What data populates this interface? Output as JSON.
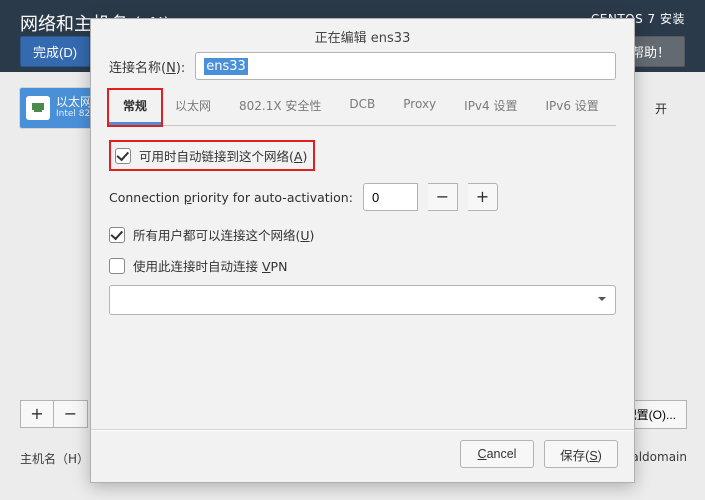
{
  "installer": {
    "page_title": "网络和主机名 (_N)",
    "right_title": "CENTOS 7 安装",
    "done_label": "完成(D)",
    "help_label": "帮助！",
    "plus": "+",
    "minus": "−",
    "config_label": "配置(O)...",
    "hostname_label": "主机名（H）:",
    "hostname_value_right": "localhost.localdomain",
    "toggle_label": "开"
  },
  "nic": {
    "title": "以太网",
    "subtitle": "Intel 82"
  },
  "dialog": {
    "title": "正在编辑 ens33",
    "conn_name_label_pref": "连接名称(",
    "conn_name_label_u": "N",
    "conn_name_label_suf": "):",
    "conn_name_value": "ens33",
    "tabs": [
      "常规",
      "以太网",
      "802.1X 安全性",
      "DCB",
      "Proxy",
      "IPv4 设置",
      "IPv6 设置"
    ],
    "active_tab": 0,
    "auto_connect_pref": "可用时自动链接到这个网络(",
    "auto_connect_u": "A",
    "auto_connect_suf": ")",
    "auto_connect_checked": true,
    "prio_label_pref": "Connection ",
    "prio_label_u": "p",
    "prio_label_suf": "riority for auto-activation:",
    "prio_value": "0",
    "all_users_pref": "所有用户都可以连接这个网络(",
    "all_users_u": "U",
    "all_users_suf": ")",
    "all_users_checked": true,
    "vpn_pref": "使用此连接时自动连接 ",
    "vpn_u": "V",
    "vpn_suf": "PN",
    "vpn_checked": false,
    "cancel_u": "C",
    "cancel_suf": "ancel",
    "save_pref": "保存(",
    "save_u": "S",
    "save_suf": ")"
  }
}
